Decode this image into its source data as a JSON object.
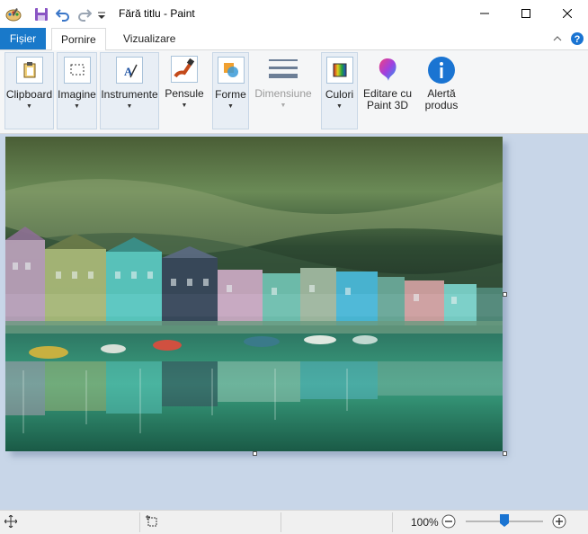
{
  "window": {
    "title": "Fără titlu - Paint",
    "quick_access": [
      "paint-app-icon",
      "save-icon",
      "undo-icon",
      "redo-icon",
      "customize-qat-icon"
    ],
    "controls": [
      "minimize-icon",
      "maximize-icon",
      "close-icon"
    ]
  },
  "menu": {
    "file_label": "Fișier",
    "tabs": [
      {
        "label": "Pornire"
      },
      {
        "label": "Vizualizare"
      }
    ],
    "collapse_icon": "chevron-up-icon",
    "help_icon": "help-icon"
  },
  "ribbon": {
    "groups": [
      {
        "label": "Clipboard"
      },
      {
        "label": "Imagine"
      },
      {
        "label": "Instrumente"
      },
      {
        "label": "Pensule"
      },
      {
        "label": "Forme"
      },
      {
        "label": "Dimensiune"
      },
      {
        "label": "Culori"
      },
      {
        "label": "Editare cu",
        "label2": "Paint 3D"
      },
      {
        "label": "Alertă",
        "label2": "produs"
      }
    ]
  },
  "status": {
    "zoom": "100%",
    "zoom_level": 1.0
  },
  "colors": {
    "file_tab": "#1979ca",
    "canvas_bg": "#c8d6e8",
    "ribbon_bg": "#f5f6f7",
    "info_blue": "#1a74d2"
  }
}
